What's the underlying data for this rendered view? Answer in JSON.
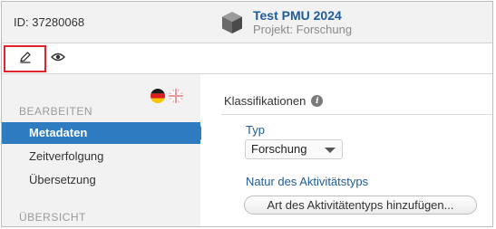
{
  "header": {
    "record_id": "ID: 37280068",
    "project_title": "Test PMU 2024",
    "project_subtitle": "Projekt: Forschung",
    "project_icon": "cube-icon"
  },
  "toolbar": {
    "edit_icon": "pencil-icon",
    "view_icon": "eye-icon"
  },
  "sidebar": {
    "flags": [
      "flag-de-icon",
      "flag-uk-icon"
    ],
    "section_edit": "BEARBEITEN",
    "items": [
      {
        "label": "Metadaten",
        "active": true
      },
      {
        "label": "Zeitverfolgung",
        "active": false
      },
      {
        "label": "Übersetzung",
        "active": false
      }
    ],
    "section_overview": "ÜBERSICHT"
  },
  "main": {
    "heading": "Klassifikationen",
    "info_icon": "info-icon",
    "type_label": "Typ",
    "type_value": "Forschung",
    "nature_label": "Natur des Aktivitätstyps",
    "add_button": "Art des Aktivitätentyps hinzufügen..."
  },
  "colors": {
    "accent": "#2e7cbf",
    "link": "#1f5c99",
    "highlight": "#e0242b"
  }
}
